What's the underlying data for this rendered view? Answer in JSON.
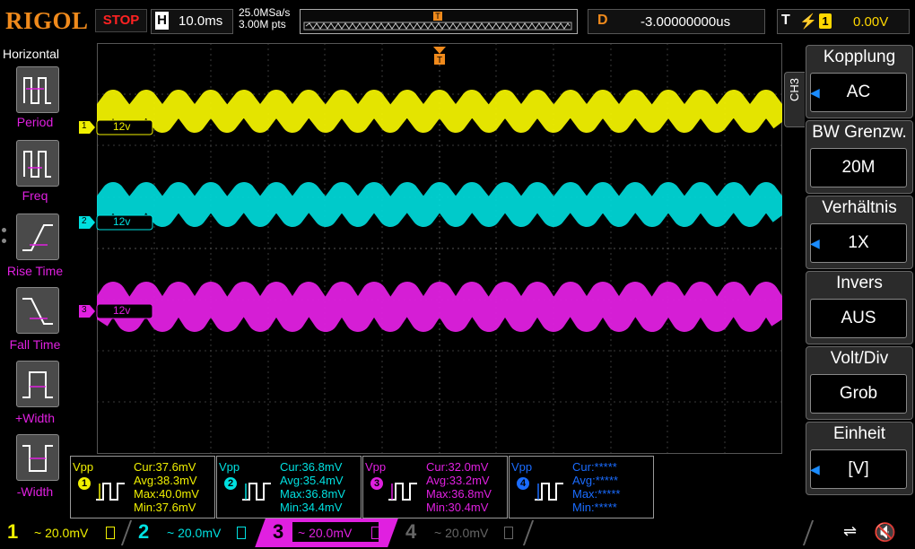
{
  "header": {
    "logo": "RIGOL",
    "status": "STOP",
    "h_key": "H",
    "timebase": "10.0ms",
    "sample_rate": "25.0MSa/s",
    "mem_depth": "3.00M pts",
    "delay_key": "D",
    "delay": "-3.00000000us",
    "trig_key": "T",
    "trig_slope_icon": "rising-edge-icon",
    "trig_source": "1",
    "trig_level": "0.00V"
  },
  "left_menu": {
    "title": "Horizontal",
    "items": [
      {
        "label": "Period",
        "icon": "period-icon"
      },
      {
        "label": "Freq",
        "icon": "freq-icon"
      },
      {
        "label": "Rise Time",
        "icon": "rise-time-icon"
      },
      {
        "label": "Fall Time",
        "icon": "fall-time-icon"
      },
      {
        "label": "+Width",
        "icon": "pos-width-icon"
      },
      {
        "label": "-Width",
        "icon": "neg-width-icon"
      }
    ]
  },
  "channels": [
    {
      "num": "1",
      "label": "12v",
      "color": "#f0f000"
    },
    {
      "num": "2",
      "label": "12v",
      "color": "#00e0e0"
    },
    {
      "num": "3",
      "label": "12v",
      "color": "#e020e0"
    }
  ],
  "right_menu": {
    "channel_tab": "CH3",
    "groups": [
      {
        "title": "Kopplung",
        "value": "AC"
      },
      {
        "title": "BW Grenzw.",
        "value": "20M"
      },
      {
        "title": "Verhältnis",
        "value": "1X"
      },
      {
        "title": "Invers",
        "value": "AUS"
      },
      {
        "title": "Volt/Div",
        "value": "Grob"
      },
      {
        "title": "Einheit",
        "value": "[V]"
      }
    ]
  },
  "measurements": [
    {
      "label": "Vpp",
      "num": "1",
      "color": "#f0f000",
      "cur": "Cur:37.6mV",
      "avg": "Avg:38.3mV",
      "max": "Max:40.0mV",
      "min": "Min:37.6mV"
    },
    {
      "label": "Vpp",
      "num": "2",
      "color": "#00e0e0",
      "cur": "Cur:36.8mV",
      "avg": "Avg:35.4mV",
      "max": "Max:36.8mV",
      "min": "Min:34.4mV"
    },
    {
      "label": "Vpp",
      "num": "3",
      "color": "#e020e0",
      "cur": "Cur:32.0mV",
      "avg": "Avg:33.2mV",
      "max": "Max:36.8mV",
      "min": "Min:30.4mV"
    },
    {
      "label": "Vpp",
      "num": "4",
      "color": "#1a6cff",
      "cur": "Cur:*****",
      "avg": "Avg:*****",
      "max": "Max:*****",
      "min": "Min:*****"
    }
  ],
  "bottom": {
    "ch1": {
      "num": "1",
      "scale": "~ 20.0mV"
    },
    "ch2": {
      "num": "2",
      "scale": "~ 20.0mV"
    },
    "ch3": {
      "num": "3",
      "scale": "~ 20.0mV"
    },
    "ch4": {
      "num": "4",
      "scale": "~ 20.0mV"
    },
    "usb_icon": "usb-icon",
    "sound_icon": "speaker-muted-icon"
  }
}
